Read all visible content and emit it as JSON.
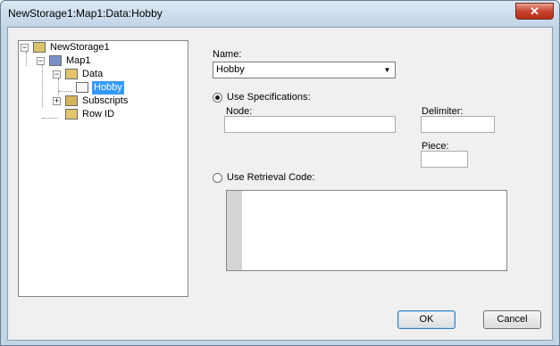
{
  "window": {
    "title": "NewStorage1:Map1:Data:Hobby",
    "close_glyph": "✕"
  },
  "tree": {
    "nodes": [
      {
        "label": "NewStorage1",
        "expander": "−",
        "icon": "storage-icon"
      },
      {
        "label": "Map1",
        "expander": "−",
        "icon": "map-icon"
      },
      {
        "label": "Data",
        "expander": "−",
        "icon": "data-folder-icon"
      },
      {
        "label": "Hobby",
        "icon": "field-ab-icon",
        "selected": true
      },
      {
        "label": "Subscripts",
        "expander": "+",
        "icon": "subscripts-icon"
      },
      {
        "label": "Row ID",
        "icon": "row-id-icon"
      }
    ]
  },
  "form": {
    "name_label": "Name:",
    "name_value": "Hobby",
    "combo_arrow": "▼",
    "use_specs_label": "Use Specifications:",
    "node_label": "Node:",
    "node_value": "",
    "delimiter_label": "Delimiter:",
    "delimiter_value": "",
    "piece_label": "Piece:",
    "piece_value": "",
    "use_retrieval_label": "Use Retrieval Code:",
    "retrieval_code": "",
    "selected_option": "use_specifications"
  },
  "buttons": {
    "ok": "OK",
    "cancel": "Cancel"
  },
  "colors": {
    "selection": "#3399ff",
    "dialog_bg": "#f0f0f0",
    "frame": "#c3d6e8"
  }
}
